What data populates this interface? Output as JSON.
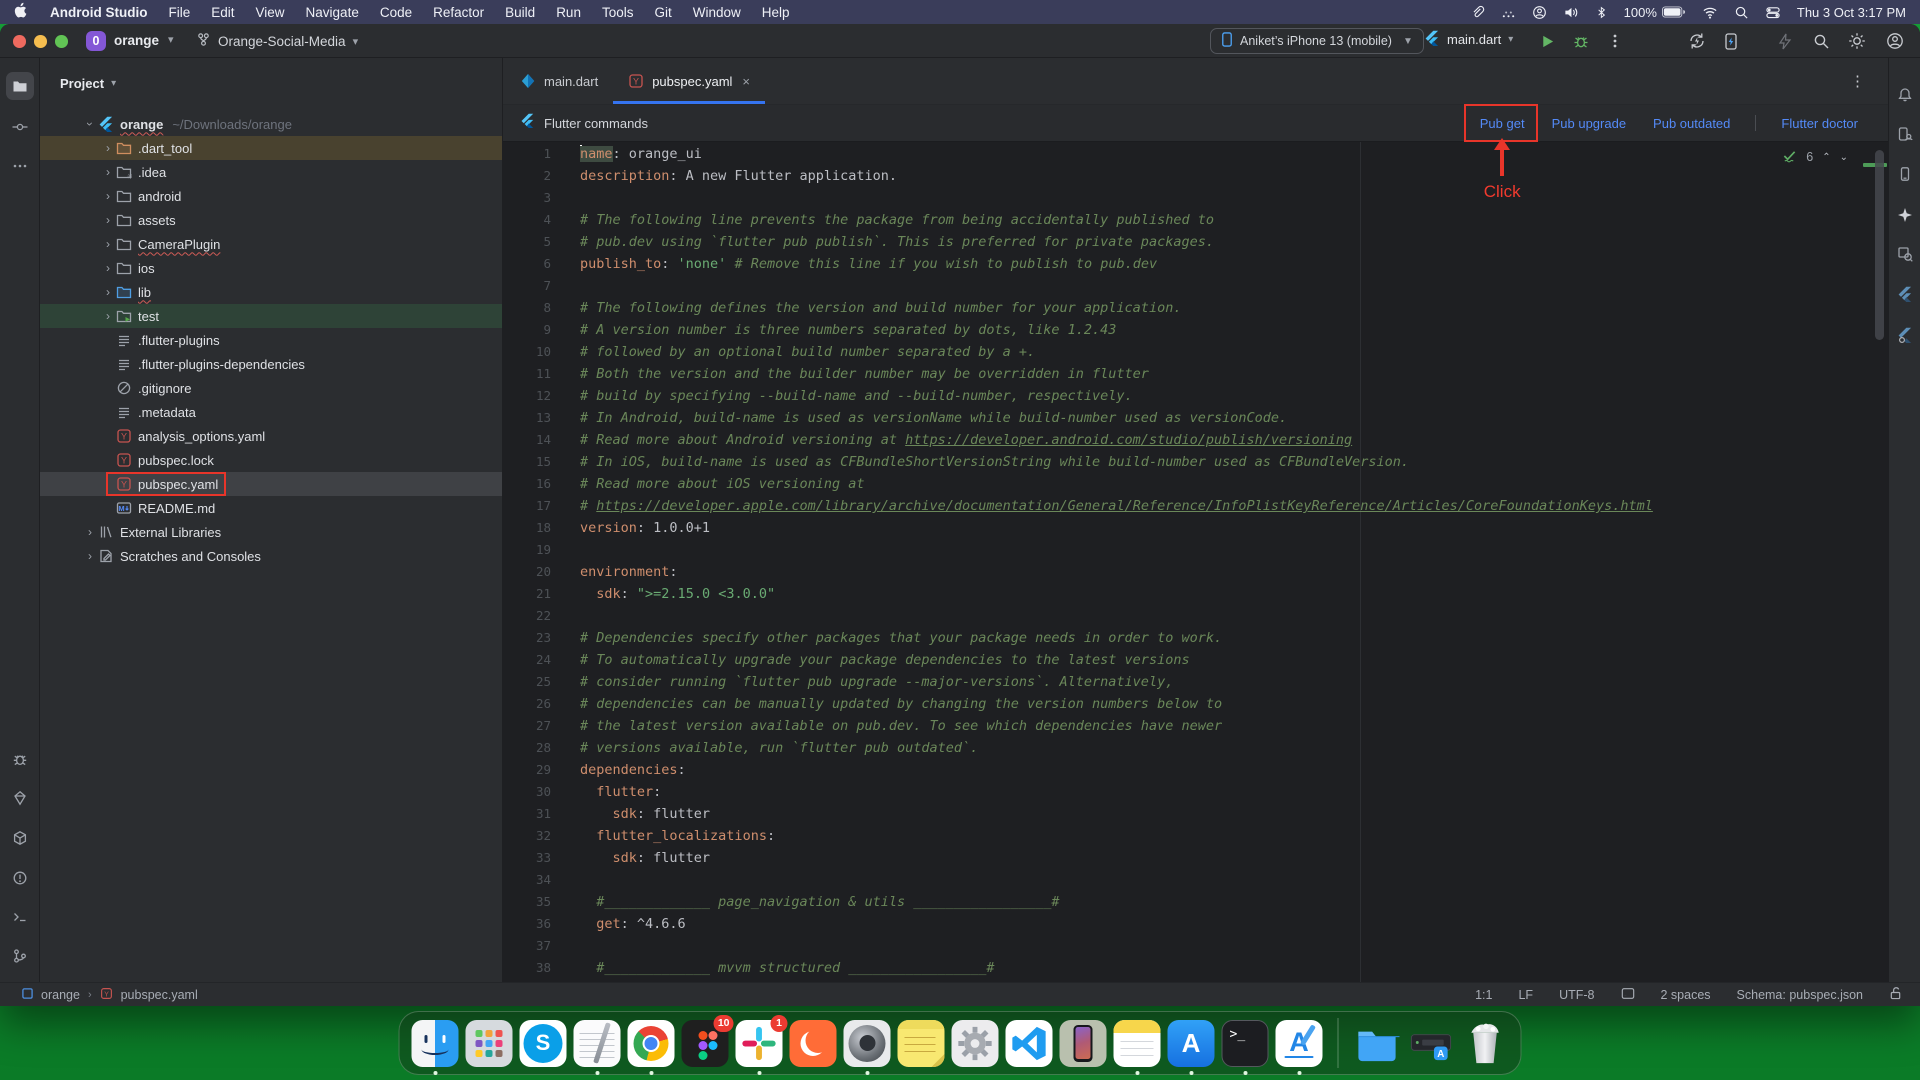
{
  "menubar": {
    "items": [
      "Android Studio",
      "File",
      "Edit",
      "View",
      "Navigate",
      "Code",
      "Refactor",
      "Build",
      "Run",
      "Tools",
      "Git",
      "Window",
      "Help"
    ],
    "status": {
      "icons": [
        "paperclip-icon",
        "screen-mirroring-icon",
        "user-switch-icon",
        "volume-icon",
        "bluetooth-icon"
      ],
      "battery_label": "100%",
      "icons_after": [
        "wifi-icon",
        "search-icon",
        "control-center-icon"
      ],
      "clock": "Thu 3 Oct  3:17 PM"
    }
  },
  "titlebar": {
    "project_badge": "0",
    "project_name": "orange",
    "branch_name": "Orange-Social-Media",
    "device_selector": "Aniket’s iPhone 13 (mobile)",
    "run_config": "main.dart"
  },
  "tab_bar": {
    "tabs": [
      {
        "label": "main.dart",
        "icon": "dart",
        "active": false
      },
      {
        "label": "pubspec.yaml",
        "icon": "yaml",
        "active": true,
        "close": "×"
      }
    ]
  },
  "banner": {
    "title": "Flutter commands",
    "actions": [
      {
        "label": "Pub get",
        "annotated": true
      },
      {
        "label": "Pub upgrade"
      },
      {
        "label": "Pub outdated"
      },
      {
        "label": "Flutter doctor",
        "separated": true
      }
    ]
  },
  "annotation": {
    "click_label": "Click"
  },
  "project_panel": {
    "header": "Project",
    "tree": [
      {
        "label": "orange",
        "suffix": "~/Downloads/orange",
        "icon": "flutter",
        "depth": 0,
        "expanded": true,
        "squiggle": true,
        "bold": true
      },
      {
        "label": ".dart_tool",
        "icon": "folder-excluded",
        "depth": 1,
        "chevron": true,
        "row": "brown"
      },
      {
        "label": ".idea",
        "icon": "folder-idea",
        "depth": 1,
        "chevron": true
      },
      {
        "label": "android",
        "icon": "folder",
        "depth": 1,
        "chevron": true
      },
      {
        "label": "assets",
        "icon": "folder",
        "depth": 1,
        "chevron": true
      },
      {
        "label": "CameraPlugin",
        "icon": "folder",
        "depth": 1,
        "chevron": true,
        "squiggle": true
      },
      {
        "label": "ios",
        "icon": "folder",
        "depth": 1,
        "chevron": true
      },
      {
        "label": "lib",
        "icon": "folder-lib",
        "depth": 1,
        "chevron": true,
        "squiggle": true
      },
      {
        "label": "test",
        "icon": "folder-test",
        "depth": 1,
        "chevron": true,
        "row": "green"
      },
      {
        "label": ".flutter-plugins",
        "icon": "text",
        "depth": 1
      },
      {
        "label": ".flutter-plugins-dependencies",
        "icon": "text",
        "depth": 1
      },
      {
        "label": ".gitignore",
        "icon": "ignore",
        "depth": 1
      },
      {
        "label": ".metadata",
        "icon": "text",
        "depth": 1
      },
      {
        "label": "analysis_options.yaml",
        "icon": "yaml",
        "depth": 1
      },
      {
        "label": "pubspec.lock",
        "icon": "yaml",
        "depth": 1
      },
      {
        "label": "pubspec.yaml",
        "icon": "yaml",
        "depth": 1,
        "selected": true,
        "annotated": true
      },
      {
        "label": "README.md",
        "icon": "markdown",
        "depth": 1
      },
      {
        "label": "External Libraries",
        "icon": "libraries",
        "depth": 0,
        "chevron": true
      },
      {
        "label": "Scratches and Consoles",
        "icon": "scratches",
        "depth": 0,
        "chevron": true
      }
    ]
  },
  "left_stripe": {
    "top": [
      "project-folder-icon",
      "commit-icon",
      "more-icon"
    ],
    "bottom": [
      "logcat-bug-icon",
      "dart-analysis-icon",
      "build-icon",
      "problems-icon",
      "terminal-icon",
      "version-control-icon"
    ]
  },
  "right_stripe": [
    "notifications-icon",
    "device-manager-icon",
    "running-devices-icon",
    "ai-assistant-icon",
    "layout-inspector-icon",
    "flutter-outline-icon",
    "flutter-inspector-icon"
  ],
  "editor": {
    "inspection_count": "6",
    "lines": [
      {
        "n": "1",
        "caret": true,
        "s": [
          [
            "key_sel",
            "name"
          ],
          [
            "plain",
            ": orange_ui"
          ]
        ]
      },
      {
        "n": "2",
        "s": [
          [
            "key",
            "description"
          ],
          [
            "plain",
            ": A new Flutter application."
          ]
        ]
      },
      {
        "n": "3",
        "s": []
      },
      {
        "n": "4",
        "s": [
          [
            "comment",
            "# The following line prevents the package from being accidentally published to"
          ]
        ]
      },
      {
        "n": "5",
        "s": [
          [
            "comment",
            "# pub.dev using `flutter pub publish`. This is preferred for private packages."
          ]
        ]
      },
      {
        "n": "6",
        "s": [
          [
            "key",
            "publish_to"
          ],
          [
            "plain",
            ": "
          ],
          [
            "string",
            "'none'"
          ],
          [
            "plain",
            " "
          ],
          [
            "comment",
            "# Remove this line if you wish to publish to pub.dev"
          ]
        ]
      },
      {
        "n": "7",
        "s": []
      },
      {
        "n": "8",
        "s": [
          [
            "comment",
            "# The following defines the version and build number for your application."
          ]
        ]
      },
      {
        "n": "9",
        "s": [
          [
            "comment",
            "# A version number is three numbers separated by dots, like 1.2.43"
          ]
        ]
      },
      {
        "n": "10",
        "s": [
          [
            "comment",
            "# followed by an optional build number separated by a +."
          ]
        ]
      },
      {
        "n": "11",
        "s": [
          [
            "comment",
            "# Both the version and the builder number may be overridden in flutter"
          ]
        ]
      },
      {
        "n": "12",
        "s": [
          [
            "comment",
            "# build by specifying --build-name and --build-number, respectively."
          ]
        ]
      },
      {
        "n": "13",
        "s": [
          [
            "comment",
            "# In Android, build-name is used as versionName while build-number used as versionCode."
          ]
        ]
      },
      {
        "n": "14",
        "s": [
          [
            "comment",
            "# Read more about Android versioning at "
          ],
          [
            "link",
            "https://developer.android.com/studio/publish/versioning"
          ]
        ]
      },
      {
        "n": "15",
        "s": [
          [
            "comment",
            "# In iOS, build-name is used as CFBundleShortVersionString while build-number used as CFBundleVersion."
          ]
        ]
      },
      {
        "n": "16",
        "s": [
          [
            "comment",
            "# Read more about iOS versioning at"
          ]
        ]
      },
      {
        "n": "17",
        "s": [
          [
            "comment",
            "# "
          ],
          [
            "link",
            "https://developer.apple.com/library/archive/documentation/General/Reference/InfoPlistKeyReference/Articles/CoreFoundationKeys.html"
          ]
        ]
      },
      {
        "n": "18",
        "s": [
          [
            "key",
            "version"
          ],
          [
            "plain",
            ": 1.0.0+1"
          ]
        ]
      },
      {
        "n": "19",
        "s": []
      },
      {
        "n": "20",
        "s": [
          [
            "key",
            "environment"
          ],
          [
            "plain",
            ":"
          ]
        ]
      },
      {
        "n": "21",
        "s": [
          [
            "plain",
            "  "
          ],
          [
            "key",
            "sdk"
          ],
          [
            "plain",
            ": "
          ],
          [
            "string",
            "\">=2.15.0 <3.0.0\""
          ]
        ]
      },
      {
        "n": "22",
        "s": []
      },
      {
        "n": "23",
        "s": [
          [
            "comment",
            "# Dependencies specify other packages that your package needs in order to work."
          ]
        ]
      },
      {
        "n": "24",
        "s": [
          [
            "comment",
            "# To automatically upgrade your package dependencies to the latest versions"
          ]
        ]
      },
      {
        "n": "25",
        "s": [
          [
            "comment",
            "# consider running `flutter pub upgrade --major-versions`. Alternatively,"
          ]
        ]
      },
      {
        "n": "26",
        "s": [
          [
            "comment",
            "# dependencies can be manually updated by changing the version numbers below to"
          ]
        ]
      },
      {
        "n": "27",
        "s": [
          [
            "comment",
            "# the latest version available on pub.dev. To see which dependencies have newer"
          ]
        ]
      },
      {
        "n": "28",
        "s": [
          [
            "comment",
            "# versions available, run `flutter pub outdated`."
          ]
        ]
      },
      {
        "n": "29",
        "s": [
          [
            "key",
            "dependencies"
          ],
          [
            "plain",
            ":"
          ]
        ]
      },
      {
        "n": "30",
        "s": [
          [
            "plain",
            "  "
          ],
          [
            "key",
            "flutter"
          ],
          [
            "plain",
            ":"
          ]
        ]
      },
      {
        "n": "31",
        "s": [
          [
            "plain",
            "    "
          ],
          [
            "key",
            "sdk"
          ],
          [
            "plain",
            ": flutter"
          ]
        ]
      },
      {
        "n": "32",
        "s": [
          [
            "plain",
            "  "
          ],
          [
            "key",
            "flutter_localizations"
          ],
          [
            "plain",
            ":"
          ]
        ]
      },
      {
        "n": "33",
        "s": [
          [
            "plain",
            "    "
          ],
          [
            "key",
            "sdk"
          ],
          [
            "plain",
            ": flutter"
          ]
        ]
      },
      {
        "n": "34",
        "s": []
      },
      {
        "n": "35",
        "s": [
          [
            "plain",
            "  "
          ],
          [
            "comment",
            "#_____________ page_navigation & utils _________________#"
          ]
        ]
      },
      {
        "n": "36",
        "s": [
          [
            "plain",
            "  "
          ],
          [
            "key",
            "get"
          ],
          [
            "plain",
            ": ^4.6.6"
          ]
        ]
      },
      {
        "n": "37",
        "s": []
      },
      {
        "n": "38",
        "s": [
          [
            "plain",
            "  "
          ],
          [
            "comment",
            "#_____________ mvvm structured _________________#"
          ]
        ]
      }
    ]
  },
  "statusbar": {
    "breadcrumb_project": "orange",
    "breadcrumb_file": "pubspec.yaml",
    "position": "1:1",
    "line_ending": "LF",
    "encoding": "UTF-8",
    "indent": "2 spaces",
    "schema": "Schema: pubspec.json"
  },
  "dock": {
    "apps": [
      {
        "name": "finder",
        "dot": true
      },
      {
        "name": "launchpad"
      },
      {
        "name": "skype"
      },
      {
        "name": "textedit",
        "dot": true
      },
      {
        "name": "chrome",
        "dot": true
      },
      {
        "name": "figma",
        "badge": "10"
      },
      {
        "name": "slack",
        "badge": "1",
        "dot": true
      },
      {
        "name": "postman"
      },
      {
        "name": "camera-lens",
        "dot": true
      },
      {
        "name": "stickies"
      },
      {
        "name": "system-settings"
      },
      {
        "name": "vscode"
      },
      {
        "name": "iphone-simulator"
      },
      {
        "name": "notes",
        "dot": true
      },
      {
        "name": "app-store",
        "dot": true
      },
      {
        "name": "terminal",
        "dot": true
      },
      {
        "name": "xcode",
        "dot": true
      },
      {
        "name": "separator"
      },
      {
        "name": "downloads-folder"
      },
      {
        "name": "external-device"
      },
      {
        "name": "trash"
      }
    ]
  }
}
